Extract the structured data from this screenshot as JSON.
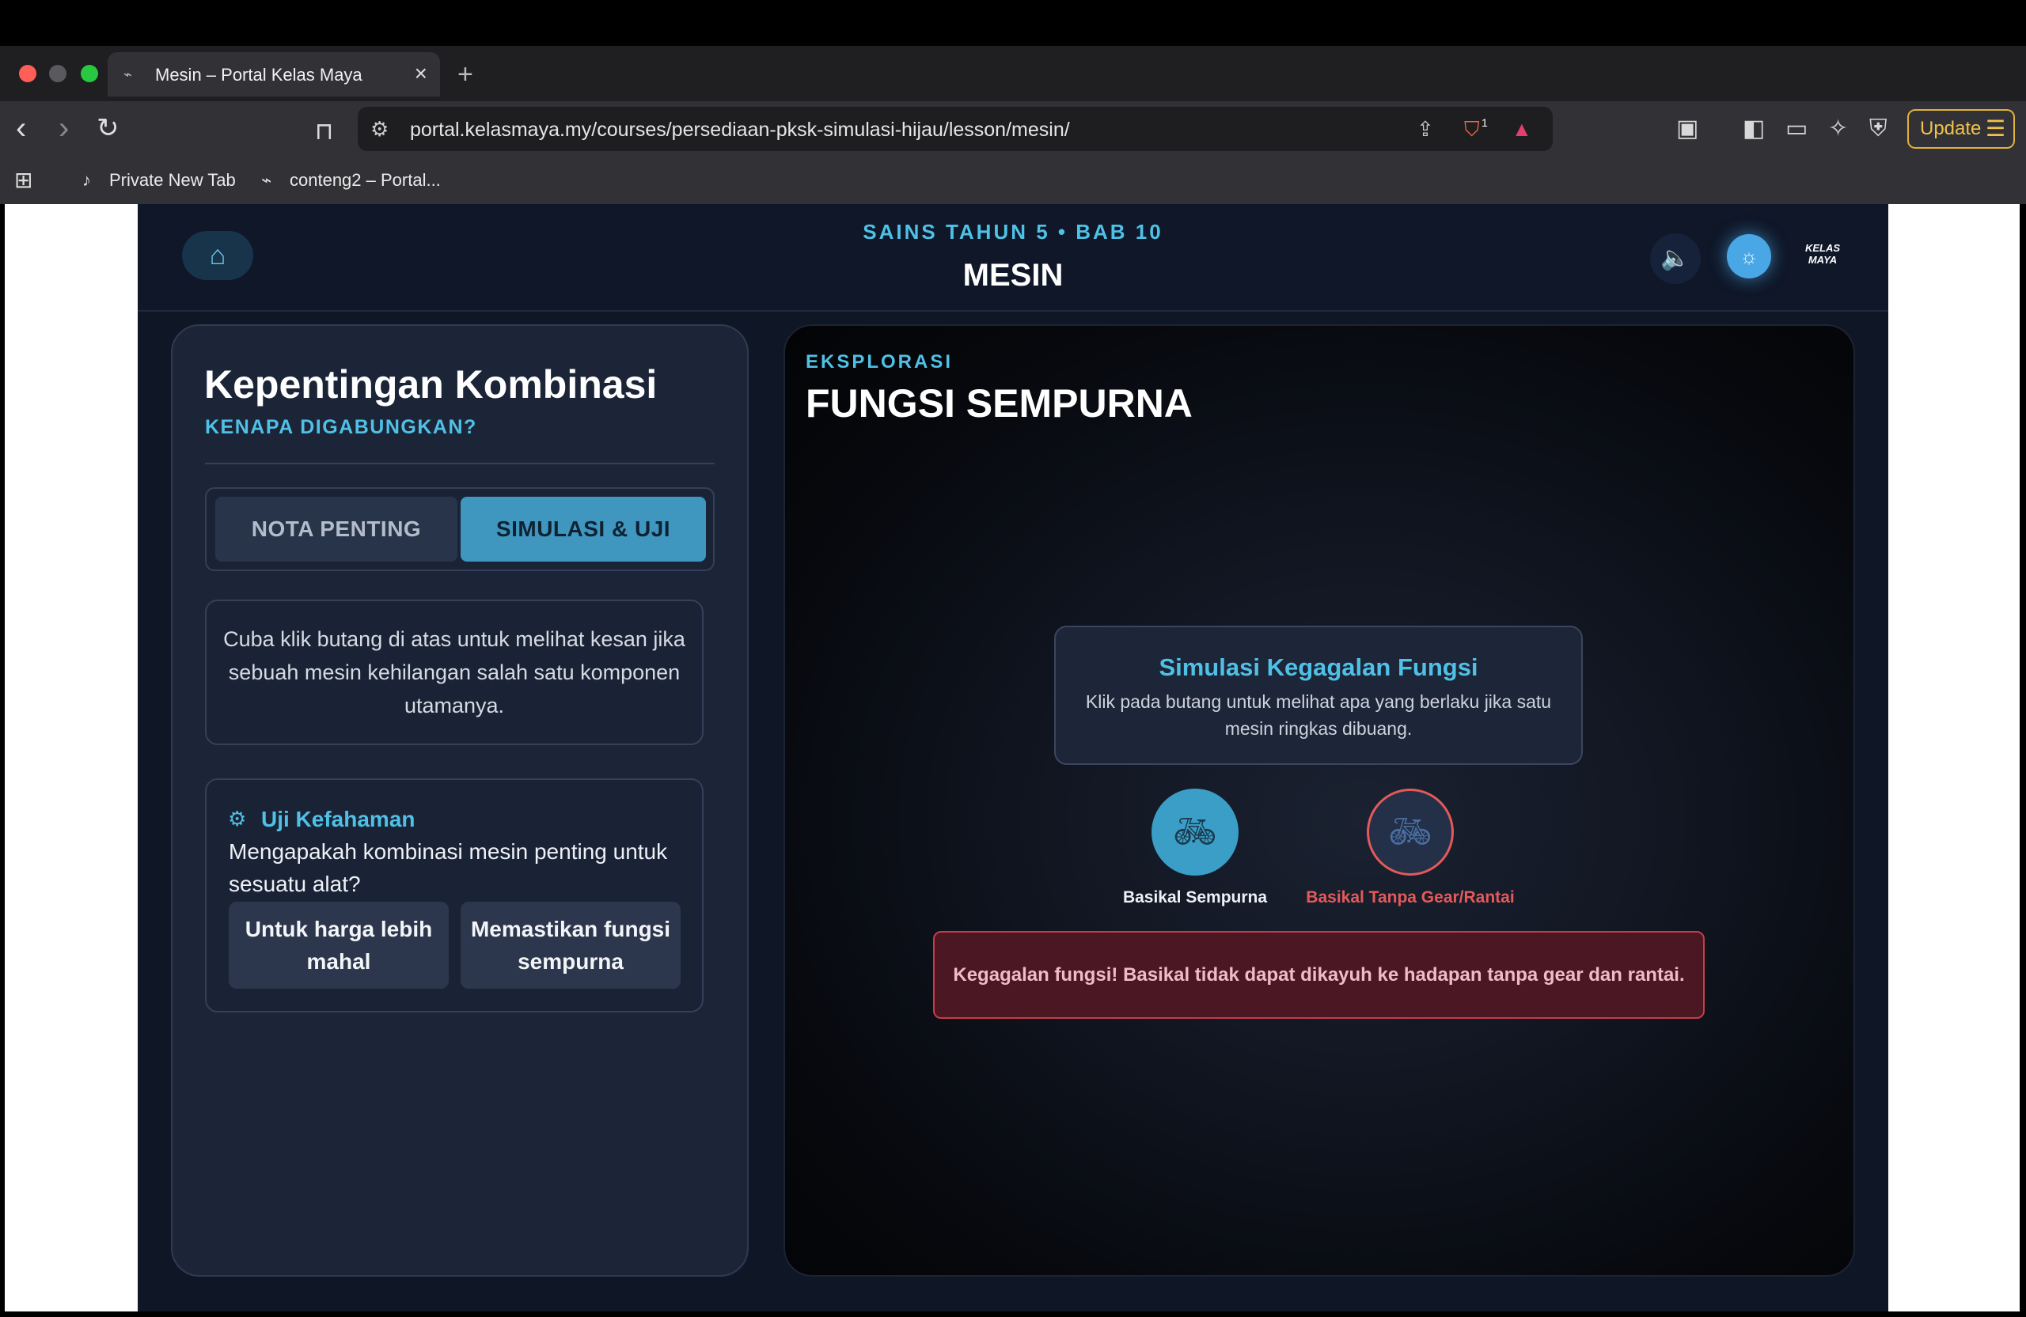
{
  "browser": {
    "tab_title": "Mesin – Portal Kelas Maya",
    "url": "portal.kelasmaya.my/courses/persediaan-pksk-simulasi-hijau/lesson/mesin/",
    "update_label": "Update",
    "brave_badge": "1",
    "bookmarks": [
      {
        "label": "Private New Tab",
        "icon": "tiktok-icon"
      },
      {
        "label": "conteng2 – Portal...",
        "icon": "site-icon"
      }
    ]
  },
  "header": {
    "breadcrumb": "SAINS TAHUN 5 • BAB 10",
    "title": "MESIN",
    "logo_text": "KELAS MAYA"
  },
  "left_panel": {
    "title": "Kepentingan Kombinasi",
    "subtitle": "KENAPA DIGABUNGKAN?",
    "tabs": [
      {
        "label": "NOTA PENTING",
        "active": false
      },
      {
        "label": "SIMULASI & UJI",
        "active": true
      }
    ],
    "info": "Cuba klik butang di atas untuk melihat kesan jika sebuah mesin kehilangan salah satu komponen utamanya.",
    "quiz": {
      "title": "Uji Kefahaman",
      "question": "Mengapakah kombinasi mesin penting untuk sesuatu alat?",
      "answers": [
        "Untuk harga lebih mahal",
        "Memastikan fungsi sempurna"
      ]
    }
  },
  "right_panel": {
    "kicker": "EKSPLORASI",
    "title": "FUNGSI SEMPURNA",
    "sim_title": "Simulasi Kegagalan Fungsi",
    "sim_desc": "Klik pada butang untuk melihat apa yang berlaku jika satu mesin ringkas dibuang.",
    "options": [
      {
        "label": "Basikal Sempurna",
        "icon": "bicycle-icon"
      },
      {
        "label": "Basikal Tanpa Gear/Rantai",
        "icon": "bicycle-icon"
      }
    ],
    "alert": "Kegagalan fungsi! Basikal tidak dapat dikayuh ke hadapan tanpa gear dan rantai."
  },
  "colors": {
    "accent": "#4fc1e6",
    "active_tab": "#3f97bf",
    "danger": "#e25a5a",
    "update": "#e0b23a"
  }
}
